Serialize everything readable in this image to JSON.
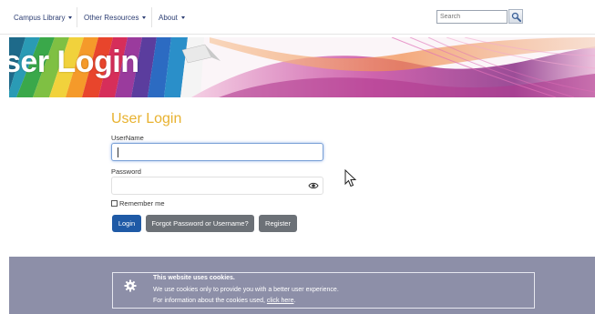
{
  "nav": {
    "items": [
      {
        "label": "Campus Library"
      },
      {
        "label": "Other Resources"
      },
      {
        "label": "About"
      }
    ],
    "search_placeholder": "Search",
    "search_icon": "magnifier-icon"
  },
  "banner": {
    "title": "ser Login"
  },
  "login": {
    "title": "User Login",
    "username_label": "UserName",
    "username_value": "",
    "password_label": "Password",
    "password_value": "",
    "remember_label": "Remember me",
    "login_button": "Login",
    "forgot_button": "Forgot Password or Username?",
    "register_button": "Register"
  },
  "cookie": {
    "title": "This website uses cookies.",
    "line1": "We use cookies only to provide you with a better user experience.",
    "line2_prefix": "For information about the cookies used,",
    "link_text": "click here",
    "line2_suffix": "."
  },
  "colors": {
    "accent_title": "#e8b230",
    "nav_text": "#2d3e73",
    "login_button": "#1f5aa6",
    "secondary_button": "#6c7177",
    "footer_bg": "#8d8fa8"
  }
}
